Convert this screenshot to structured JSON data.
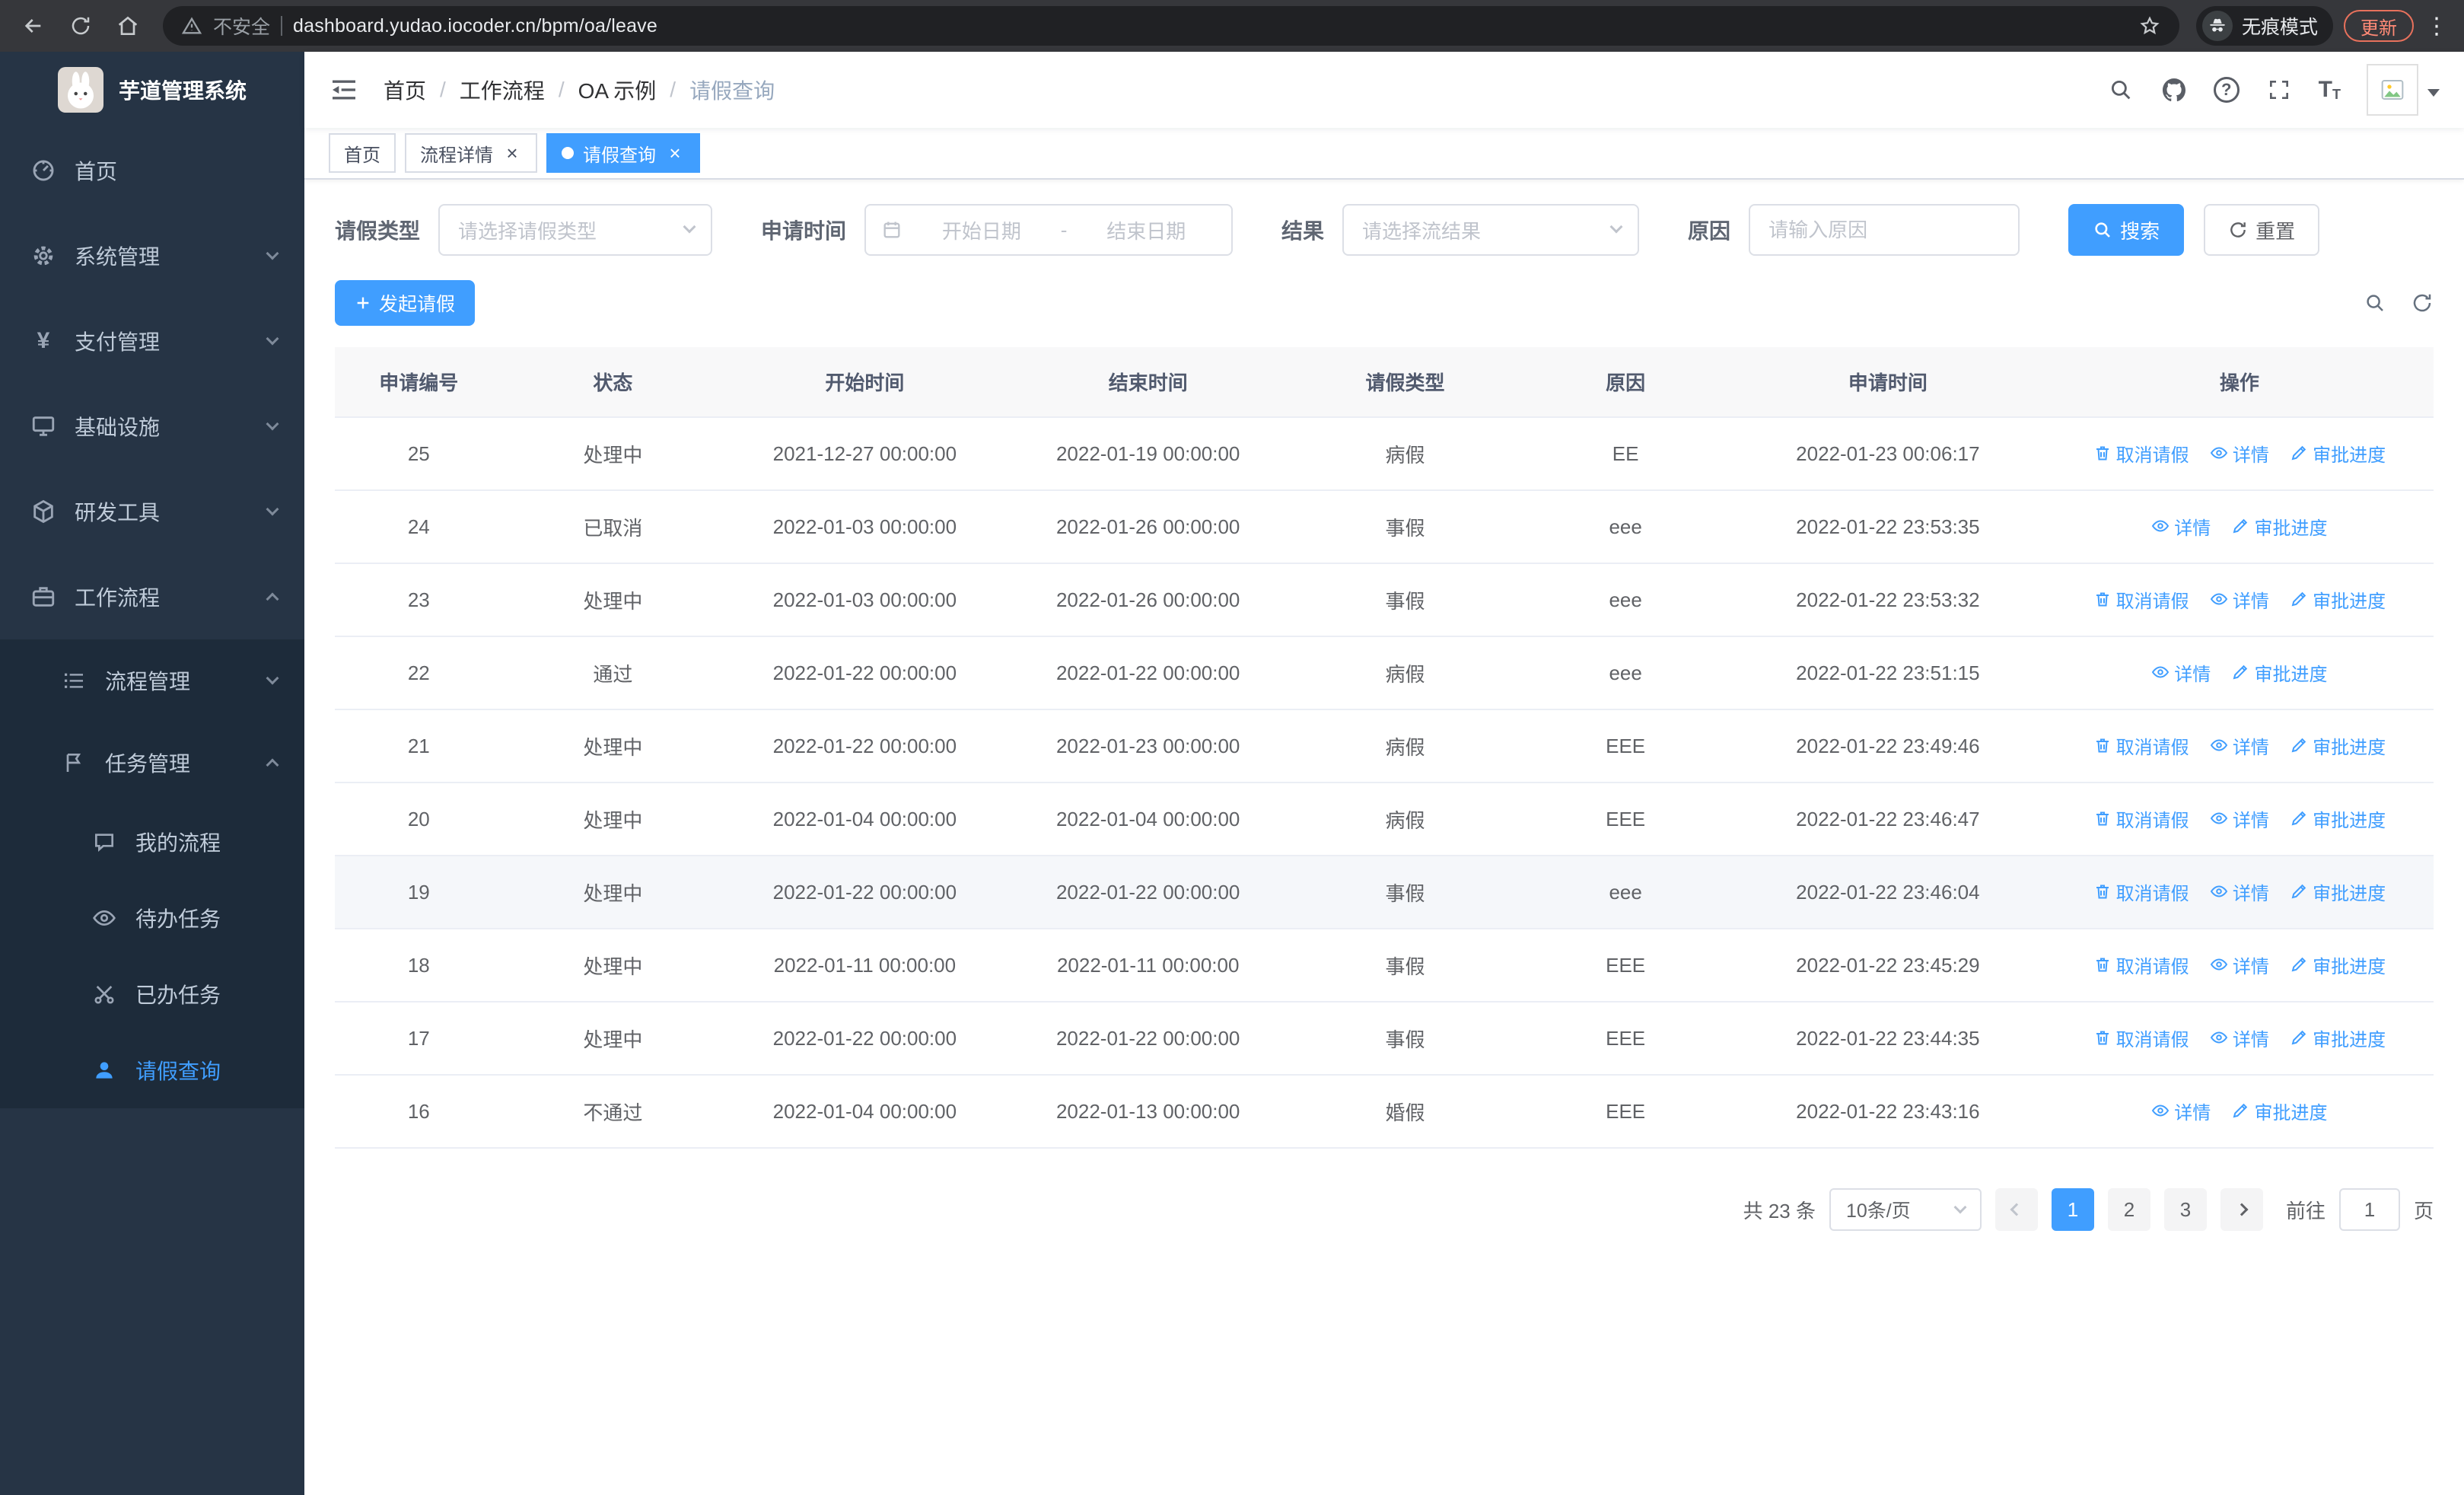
{
  "colors": {
    "accent": "#409eff",
    "sidebar_bg": "#263445",
    "submenu_bg": "#1d2b3a",
    "chrome_bg": "#36373b",
    "header_bg": "#f8f8f9"
  },
  "icons": {
    "close": "×",
    "kebab": "⋮",
    "question": "?",
    "yen": "¥",
    "font_size_big": "T",
    "font_size_small": "T"
  },
  "browser": {
    "security_label": "不安全",
    "url": "dashboard.yudao.iocoder.cn/bpm/oa/leave",
    "incognito_label": "无痕模式",
    "update_label": "更新"
  },
  "sidebar": {
    "logo_title": "芋道管理系统",
    "items": [
      {
        "label": "首页",
        "icon": "dashboard-icon"
      },
      {
        "label": "系统管理",
        "icon": "gear-icon"
      },
      {
        "label": "支付管理",
        "icon": "yen-icon"
      },
      {
        "label": "基础设施",
        "icon": "infrastructure-icon"
      },
      {
        "label": "研发工具",
        "icon": "dev-tools-icon"
      },
      {
        "label": "工作流程",
        "icon": "workflow-icon",
        "expanded": true
      }
    ],
    "submenu": [
      {
        "label": "流程管理",
        "icon": "process-icon"
      },
      {
        "label": "任务管理",
        "icon": "task-icon",
        "expanded": true
      }
    ],
    "nested": [
      {
        "label": "我的流程",
        "icon": "my-process-icon"
      },
      {
        "label": "待办任务",
        "icon": "todo-icon"
      },
      {
        "label": "已办任务",
        "icon": "done-icon"
      },
      {
        "label": "请假查询",
        "icon": "leave-query-icon",
        "active": true
      }
    ]
  },
  "header": {
    "breadcrumb": [
      "首页",
      "工作流程",
      "OA 示例",
      "请假查询"
    ],
    "separator": "/"
  },
  "tabs": [
    {
      "label": "首页",
      "closable": false,
      "active": false
    },
    {
      "label": "流程详情",
      "closable": true,
      "active": false
    },
    {
      "label": "请假查询",
      "closable": true,
      "active": true
    }
  ],
  "filters": {
    "leave_type_label": "请假类型",
    "leave_type_placeholder": "请选择请假类型",
    "apply_time_label": "申请时间",
    "start_date_placeholder": "开始日期",
    "date_separator": "-",
    "end_date_placeholder": "结束日期",
    "result_label": "结果",
    "result_placeholder": "请选择流结果",
    "reason_label": "原因",
    "reason_placeholder": "请输入原因",
    "search_label": "搜索",
    "reset_label": "重置"
  },
  "toolbar": {
    "create_label": "发起请假"
  },
  "table": {
    "columns": [
      "申请编号",
      "状态",
      "开始时间",
      "结束时间",
      "请假类型",
      "原因",
      "申请时间",
      "操作"
    ],
    "action_labels": {
      "cancel": "取消请假",
      "detail": "详情",
      "progress": "审批进度"
    },
    "rows": [
      {
        "id": "25",
        "status": "处理中",
        "start": "2021-12-27 00:00:00",
        "end": "2022-01-19 00:00:00",
        "type": "病假",
        "reason": "EE",
        "applied": "2022-01-23 00:06:17",
        "actions": [
          "cancel",
          "detail",
          "progress"
        ]
      },
      {
        "id": "24",
        "status": "已取消",
        "start": "2022-01-03 00:00:00",
        "end": "2022-01-26 00:00:00",
        "type": "事假",
        "reason": "eee",
        "applied": "2022-01-22 23:53:35",
        "actions": [
          "detail",
          "progress"
        ]
      },
      {
        "id": "23",
        "status": "处理中",
        "start": "2022-01-03 00:00:00",
        "end": "2022-01-26 00:00:00",
        "type": "事假",
        "reason": "eee",
        "applied": "2022-01-22 23:53:32",
        "actions": [
          "cancel",
          "detail",
          "progress"
        ]
      },
      {
        "id": "22",
        "status": "通过",
        "start": "2022-01-22 00:00:00",
        "end": "2022-01-22 00:00:00",
        "type": "病假",
        "reason": "eee",
        "applied": "2022-01-22 23:51:15",
        "actions": [
          "detail",
          "progress"
        ]
      },
      {
        "id": "21",
        "status": "处理中",
        "start": "2022-01-22 00:00:00",
        "end": "2022-01-23 00:00:00",
        "type": "病假",
        "reason": "EEE",
        "applied": "2022-01-22 23:49:46",
        "actions": [
          "cancel",
          "detail",
          "progress"
        ]
      },
      {
        "id": "20",
        "status": "处理中",
        "start": "2022-01-04 00:00:00",
        "end": "2022-01-04 00:00:00",
        "type": "病假",
        "reason": "EEE",
        "applied": "2022-01-22 23:46:47",
        "actions": [
          "cancel",
          "detail",
          "progress"
        ]
      },
      {
        "id": "19",
        "status": "处理中",
        "start": "2022-01-22 00:00:00",
        "end": "2022-01-22 00:00:00",
        "type": "事假",
        "reason": "eee",
        "applied": "2022-01-22 23:46:04",
        "actions": [
          "cancel",
          "detail",
          "progress"
        ]
      },
      {
        "id": "18",
        "status": "处理中",
        "start": "2022-01-11 00:00:00",
        "end": "2022-01-11 00:00:00",
        "type": "事假",
        "reason": "EEE",
        "applied": "2022-01-22 23:45:29",
        "actions": [
          "cancel",
          "detail",
          "progress"
        ]
      },
      {
        "id": "17",
        "status": "处理中",
        "start": "2022-01-22 00:00:00",
        "end": "2022-01-22 00:00:00",
        "type": "事假",
        "reason": "EEE",
        "applied": "2022-01-22 23:44:35",
        "actions": [
          "cancel",
          "detail",
          "progress"
        ]
      },
      {
        "id": "16",
        "status": "不通过",
        "start": "2022-01-04 00:00:00",
        "end": "2022-01-13 00:00:00",
        "type": "婚假",
        "reason": "EEE",
        "applied": "2022-01-22 23:43:16",
        "actions": [
          "detail",
          "progress"
        ]
      }
    ]
  },
  "pagination": {
    "total_label": "共 23 条",
    "page_size": "10条/页",
    "pages": [
      "1",
      "2",
      "3"
    ],
    "active_page": "1",
    "goto_label": "前往",
    "goto_value": "1",
    "page_unit": "页"
  }
}
